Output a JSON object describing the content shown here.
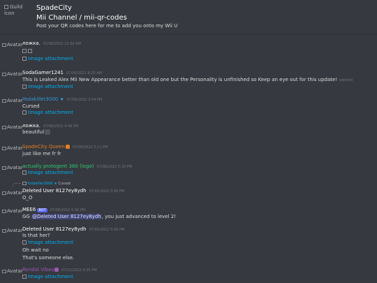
{
  "header": {
    "guild_icon_alt": "Guild icon",
    "guild_name": "SpadeCity",
    "channel_name": " Mii Channel / mii-qr-codes",
    "channel_topic": "Post your QR codes here for me to add you onto my Wii U"
  },
  "colors": {
    "background": "#36393f",
    "link": "#00aff4",
    "role_orange": "#e67e22",
    "role_blue": "#3498db",
    "role_green": "#2ecc71",
    "role_purple": "#9b59b6",
    "bot_tag": "#5865f2"
  },
  "avatar_alt": "Avatar",
  "attachment_label": "Image attachment",
  "messages": [
    {
      "author": "ложка.",
      "timestamp": "07/06/2022 12:30 AM"
    },
    {
      "author": "SodaGamer1241",
      "timestamp": "07/06/2022 8:10 AM",
      "text": "This is Leaked Alex Mii New Appearance better than old one but the Personality is unfinished so Keep an eye out for this update!",
      "edited": "(edited)"
    },
    {
      "author": "Yodakiller3000 ★",
      "timestamp": "07/06/2022 3:54 PM",
      "text": "Cursed"
    },
    {
      "author": "ложка.",
      "timestamp": "07/06/2022 4:46 PM",
      "text": "beautiful"
    },
    {
      "author": "SpadeCity Queen",
      "timestamp": "07/06/2022 5:11 PM",
      "text": "just like me fr fr"
    },
    {
      "author": "actually protogent 360 (logo)",
      "timestamp": "07/06/2022 5:30 PM"
    },
    {
      "reply_author": "Yodakiller3000 ★",
      "reply_text": "Cursed",
      "author": "Deleted User 8127ey8ydh",
      "timestamp": "07/06/2022 5:56 PM",
      "text": "O_O"
    },
    {
      "author": "MEE6",
      "bot_label": "BOT",
      "timestamp": "07/06/2022 5:56 PM",
      "text_prefix": "GG",
      "mention": "@Deleted User 8127ey8ydh",
      "text_suffix": ", you just advanced to level 2!"
    },
    {
      "author": "Deleted User 8127ey8ydh",
      "timestamp": "07/06/2022 5:58 PM",
      "text": "Is that her?",
      "text2": "Oh wait no",
      "text3": "That's someone else."
    },
    {
      "author": "Rendal Vibes",
      "timestamp": "07/22/2022 4:35 PM"
    }
  ]
}
